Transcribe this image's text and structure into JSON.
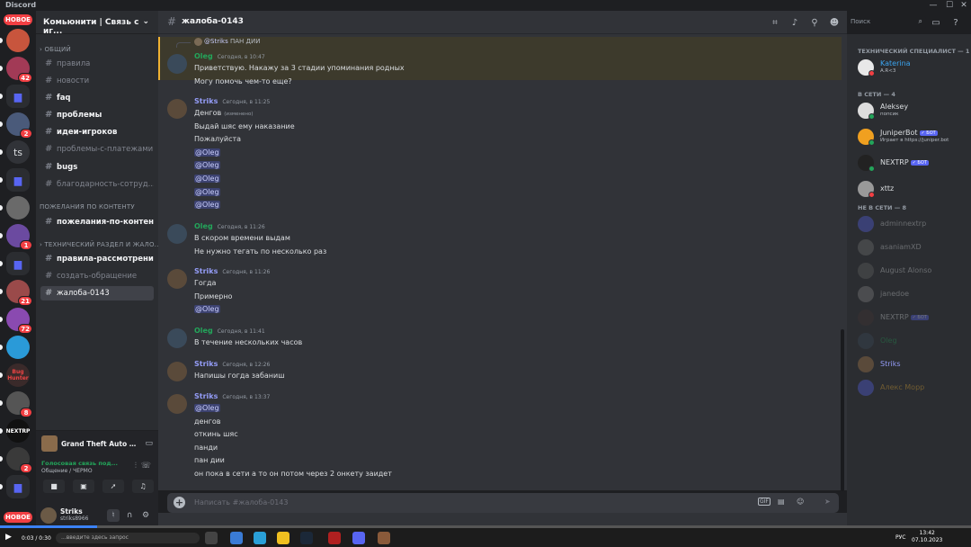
{
  "window": {
    "title": "Discord",
    "minimize": "—",
    "maximize": "☐",
    "close": "✕"
  },
  "rail": {
    "new_top": "НОВОЕ",
    "new_bottom": "НОВОЕ",
    "servers": [
      {
        "label": "",
        "badge": "",
        "color": "#c8553d"
      },
      {
        "label": "",
        "badge": "42",
        "color": "#a23a56"
      },
      {
        "label": "▆",
        "badge": "",
        "color": "",
        "folder": true
      },
      {
        "label": "",
        "badge": "2",
        "color": "#4a5a7a"
      },
      {
        "label": "ts",
        "badge": "",
        "color": "#313338"
      },
      {
        "label": "▆",
        "badge": "",
        "color": "",
        "folder": true
      },
      {
        "label": "",
        "badge": "",
        "color": "#6a6a6a"
      },
      {
        "label": "",
        "badge": "1",
        "color": "#6b4aa0"
      },
      {
        "label": "▆",
        "badge": "",
        "color": "",
        "folder": true
      },
      {
        "label": "",
        "badge": "21",
        "color": "#9a4a4a"
      },
      {
        "label": "",
        "badge": "72",
        "color": "#8a4ab0"
      },
      {
        "label": "",
        "badge": "",
        "color": "#2a9ad8"
      },
      {
        "label": "Bug Hunter",
        "badge": "",
        "color": "#3a2a2a"
      },
      {
        "label": "",
        "badge": "8",
        "color": "#555555"
      },
      {
        "label": "NEXTRP",
        "badge": "",
        "color": "#111111"
      },
      {
        "label": "",
        "badge": "2",
        "color": "#3a3a3a"
      },
      {
        "label": "▆",
        "badge": "",
        "color": "",
        "folder": true
      }
    ]
  },
  "guild": {
    "name": "Комьюнити | Связь с иг...",
    "chevron": "⌄"
  },
  "categories": {
    "general": "общий",
    "wishes": "пожелания по контенту",
    "tech": "технический раздел и жало..."
  },
  "channels": {
    "rules": "правила",
    "news": "новости",
    "faq": "faq",
    "problems": "проблемы",
    "ideas": "идеи-игроков",
    "payments": "проблемы-с-платежами",
    "bugs": "bugs",
    "thanks": "благодарность-сотруд...",
    "wishes_content": "пожелания-по-контенту",
    "review_rules": "правила-рассмотрения...",
    "create_ticket": "создать-обращение",
    "complaint": "жалоба-0143"
  },
  "activity": {
    "name": "Grand Theft Auto San ..."
  },
  "voice": {
    "status": "Голосовая связь под...",
    "sub": "Общение / ЧЕРМО"
  },
  "user": {
    "name": "Striks",
    "tag": "striks8966"
  },
  "chat": {
    "channel": "жалоба-0143",
    "search_placeholder": "Поиск",
    "input_placeholder": "Написать #жалоба-0143",
    "gif": "GIF",
    "reply": {
      "mention": "@Striks",
      "text": " ПАН ДИИ"
    },
    "messages": [
      {
        "author": "Oleg",
        "time": "Сегодня, в 10:47",
        "color": "#23a55a",
        "avatar": "#3a4a5a",
        "lines": [
          {
            "text": "Приветствую. Накажу за 3 стадии упоминания родных"
          },
          {
            "text": "Могу помочь чем-то еще?"
          }
        ]
      },
      {
        "author": "Striks",
        "time": "Сегодня, в 11:25",
        "color": "#949cf7",
        "avatar": "#5a4a3a",
        "lines": [
          {
            "text": "Денгов",
            "edited": "(изменено)"
          },
          {
            "text": "Выдай шяс ему наказание"
          },
          {
            "text": "Пожалуйста"
          },
          {
            "mention": "@Oleg"
          },
          {
            "mention": "@Oleg"
          },
          {
            "mention": "@Oleg"
          },
          {
            "mention": "@Oleg"
          },
          {
            "mention": "@Oleg"
          }
        ]
      },
      {
        "author": "Oleg",
        "time": "Сегодня, в 11:26",
        "color": "#23a55a",
        "avatar": "#3a4a5a",
        "lines": [
          {
            "text": "В скором времени выдам"
          },
          {
            "text": "Не нужно тегать по несколько раз"
          }
        ]
      },
      {
        "author": "Striks",
        "time": "Сегодня, в 11:26",
        "color": "#949cf7",
        "avatar": "#5a4a3a",
        "lines": [
          {
            "text": "Гогда"
          },
          {
            "text": "Примерно"
          },
          {
            "mention": "@Oleg"
          }
        ]
      },
      {
        "author": "Oleg",
        "time": "Сегодня, в 11:41",
        "color": "#23a55a",
        "avatar": "#3a4a5a",
        "lines": [
          {
            "text": "В течение нескольких часов"
          }
        ]
      },
      {
        "author": "Striks",
        "time": "Сегодня, в 12:26",
        "color": "#949cf7",
        "avatar": "#5a4a3a",
        "lines": [
          {
            "text": "Напишы гогда забаниш"
          }
        ]
      },
      {
        "author": "Striks",
        "time": "Сегодня, в 13:37",
        "color": "#949cf7",
        "avatar": "#5a4a3a",
        "lines": [
          {
            "mention": "@Oleg"
          },
          {
            "text": "денгов"
          },
          {
            "text": "откинь шяс"
          },
          {
            "text": "панди"
          },
          {
            "text": "пан дии"
          },
          {
            "text": "он пока в сети а то он потом через 2 онкету заидет"
          }
        ]
      }
    ]
  },
  "members": {
    "groups": {
      "tech": "технический специалист — 1",
      "online": "в сети — 4",
      "offline": "не в сети — 8"
    },
    "bot_tag": "✓ БОТ",
    "tech": [
      {
        "name": "Katerina",
        "status": "A.R<3",
        "color": "#3ba4f0",
        "dot": "#f23f43",
        "avatar": "#e8e8e8"
      }
    ],
    "online": [
      {
        "name": "Aleksey",
        "status": "попсик",
        "color": "#dbdee1",
        "dot": "#23a55a",
        "avatar": "#dddddd"
      },
      {
        "name": "JuniperBot",
        "status": "Играет в https://juniper.bot",
        "color": "#dbdee1",
        "dot": "#23a55a",
        "avatar": "#f0a020",
        "bot": true
      },
      {
        "name": "NEXTRP",
        "status": "",
        "color": "#dbdee1",
        "dot": "#23a55a",
        "avatar": "#222222",
        "bot": true
      },
      {
        "name": "xttz",
        "status": "",
        "color": "#dbdee1",
        "dot": "#f23f43",
        "avatar": "#999999"
      }
    ],
    "offline": [
      {
        "name": "adminnextrp",
        "color": "#dbdee1",
        "avatar": "#5865f2"
      },
      {
        "name": "asaniamXD",
        "color": "#dbdee1",
        "avatar": "#777777"
      },
      {
        "name": "August Alonso",
        "color": "#dbdee1",
        "avatar": "#666666"
      },
      {
        "name": "janedoe",
        "color": "#dbdee1",
        "avatar": "#888888"
      },
      {
        "name": "NEXTRP",
        "color": "#dbdee1",
        "avatar": "#443333",
        "bot": true
      },
      {
        "name": "Oleg",
        "color": "#23a55a",
        "avatar": "#3a4a5a"
      },
      {
        "name": "Striks",
        "color": "#949cf7",
        "avatar": "#5a4a3a",
        "full": true
      },
      {
        "name": "Алекс Морр",
        "color": "#f0b232",
        "avatar": "#5865f2"
      }
    ]
  },
  "taskbar": {
    "video_time": "0:03 / 0:30",
    "search_placeholder": "...введите здесь запрос",
    "lang": "РУС",
    "clock_time": "13:42",
    "clock_date": "07.10.2023",
    "video_progress": 0.1
  }
}
